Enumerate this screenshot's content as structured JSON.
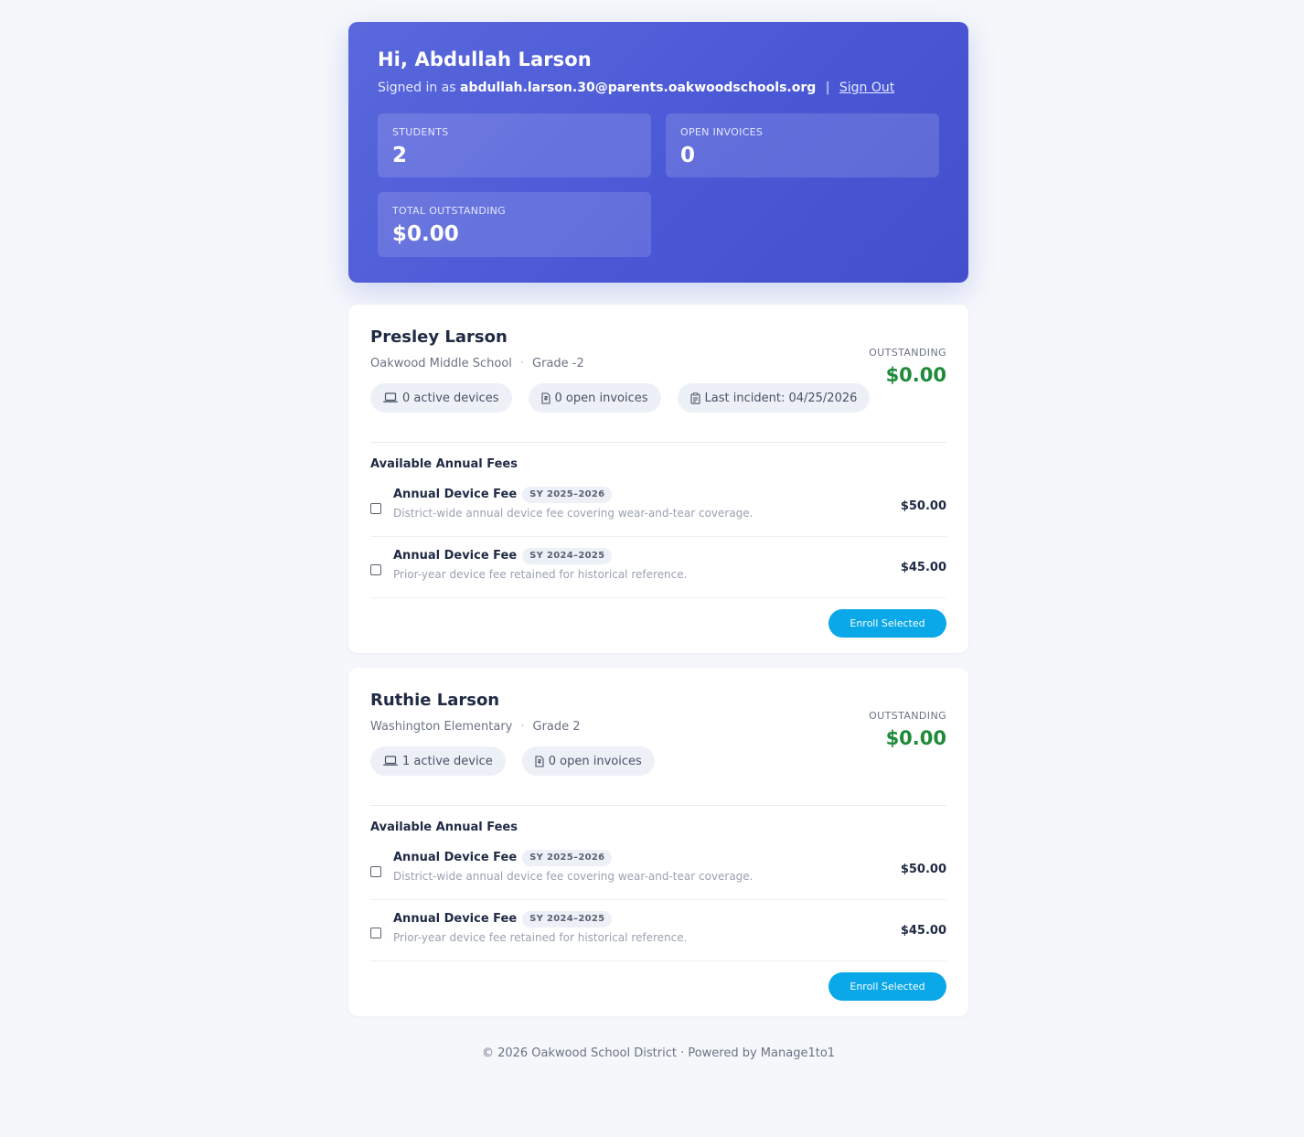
{
  "header": {
    "greeting": "Hi, Abdullah Larson",
    "signed_in_prefix": "Signed in as",
    "email": "abdullah.larson.30@parents.oakwoodschools.org",
    "separator": "|",
    "sign_out": "Sign Out"
  },
  "stats": [
    {
      "label": "STUDENTS",
      "value": "2"
    },
    {
      "label": "OPEN INVOICES",
      "value": "0"
    },
    {
      "label": "TOTAL OUTSTANDING",
      "value": "$0.00"
    }
  ],
  "students": [
    {
      "name": "Presley Larson",
      "school": "Oakwood Middle School",
      "grade": "Grade -2",
      "chips": {
        "devices": "0 active devices",
        "invoices": "0 open invoices",
        "incident": "Last incident: 04/25/2026"
      },
      "outstanding_label": "OUTSTANDING",
      "outstanding_amount": "$0.00",
      "fees_title": "Available Annual Fees",
      "fees": [
        {
          "title": "Annual Device Fee",
          "year": "SY 2025–2026",
          "description": "District-wide annual device fee covering wear-and-tear coverage.",
          "price": "$50.00"
        },
        {
          "title": "Annual Device Fee",
          "year": "SY 2024–2025",
          "description": "Prior-year device fee retained for historical reference.",
          "price": "$45.00"
        }
      ],
      "enroll_label": "Enroll Selected"
    },
    {
      "name": "Ruthie Larson",
      "school": "Washington Elementary",
      "grade": "Grade 2",
      "chips": {
        "devices": "1 active device",
        "invoices": "0 open invoices"
      },
      "outstanding_label": "OUTSTANDING",
      "outstanding_amount": "$0.00",
      "fees_title": "Available Annual Fees",
      "fees": [
        {
          "title": "Annual Device Fee",
          "year": "SY 2025–2026",
          "description": "District-wide annual device fee covering wear-and-tear coverage.",
          "price": "$50.00"
        },
        {
          "title": "Annual Device Fee",
          "year": "SY 2024–2025",
          "description": "Prior-year device fee retained for historical reference.",
          "price": "$45.00"
        }
      ],
      "enroll_label": "Enroll Selected"
    }
  ],
  "footer": "© 2026 Oakwood School District · Powered by Manage1to1",
  "colors": {
    "hero_gradient_start": "#5a68dc",
    "hero_gradient_end": "#4250cc",
    "outstanding_green": "#1e8a3a",
    "enroll_button": "#0aa8e8"
  },
  "icons": {
    "devices": "laptop-icon",
    "invoices": "invoice-icon",
    "incident": "clipboard-icon"
  }
}
